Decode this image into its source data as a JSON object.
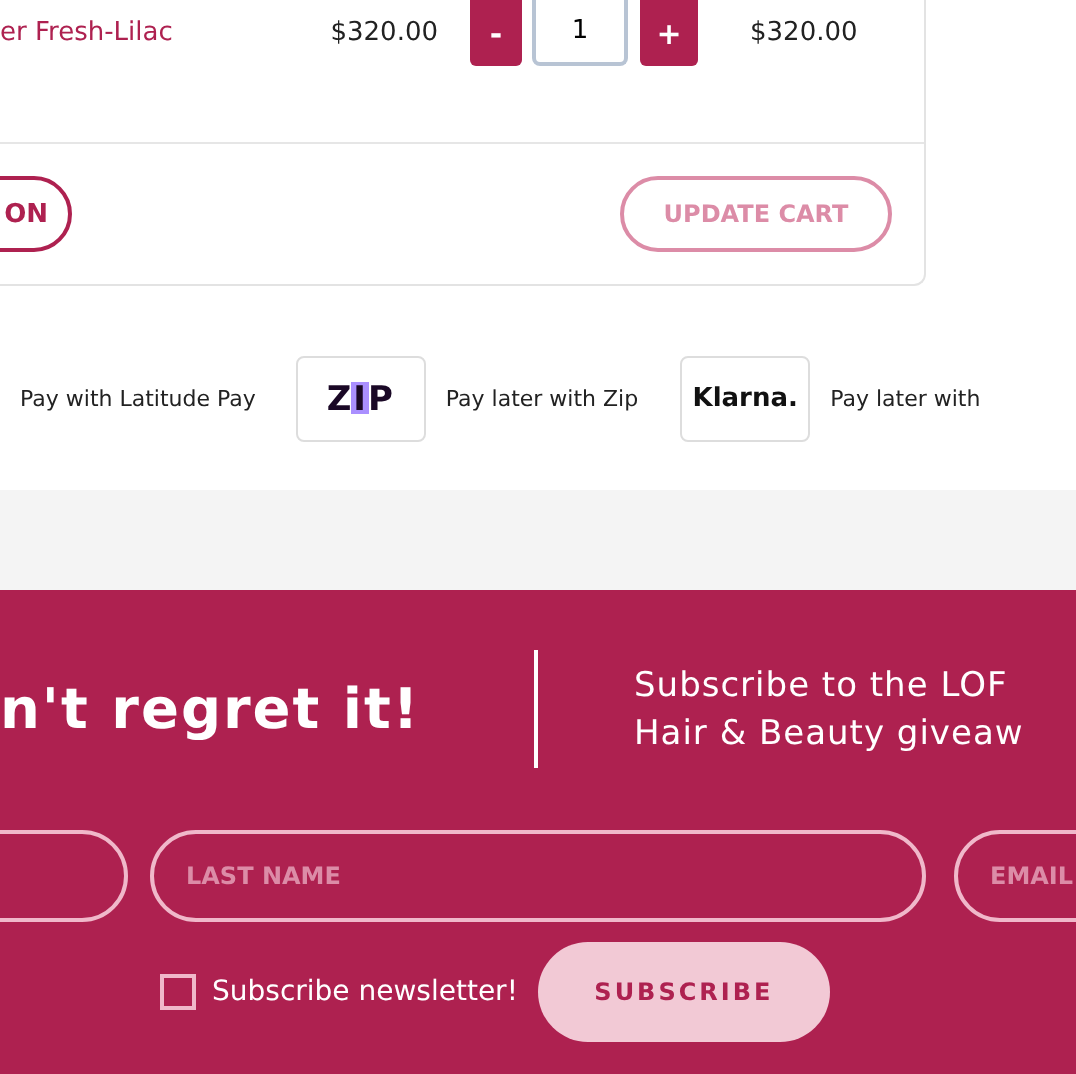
{
  "cart": {
    "item": {
      "name": "er Fresh-Lilac",
      "price": "$320.00",
      "decrement": "-",
      "quantity": "1",
      "increment": "+",
      "subtotal": "$320.00"
    },
    "buttons": [
      {
        "label": "ON",
        "disabled": false
      },
      {
        "label": "UPDATE CART",
        "disabled": true
      }
    ]
  },
  "payments": [
    {
      "kind": "text",
      "label": "Pay with Latitude Pay"
    },
    {
      "kind": "zip",
      "logo": "ZIP",
      "label": "Pay later with Zip"
    },
    {
      "kind": "klarna",
      "logo": "Klarna.",
      "label": "Pay later with"
    }
  ],
  "newsletter": {
    "heading": "n't regret it!",
    "description": [
      "Subscribe to the LOF",
      "Hair & Beauty giveaw"
    ],
    "fields": [
      {
        "kind": "input"
      },
      {
        "kind": "input",
        "placeholder": "LAST NAME"
      },
      {
        "kind": "input",
        "placeholder": "EMAIL"
      }
    ],
    "checkbox": {
      "label": "Subscribe newsletter!",
      "checked": false
    },
    "button": "SUBSCRIBE"
  }
}
